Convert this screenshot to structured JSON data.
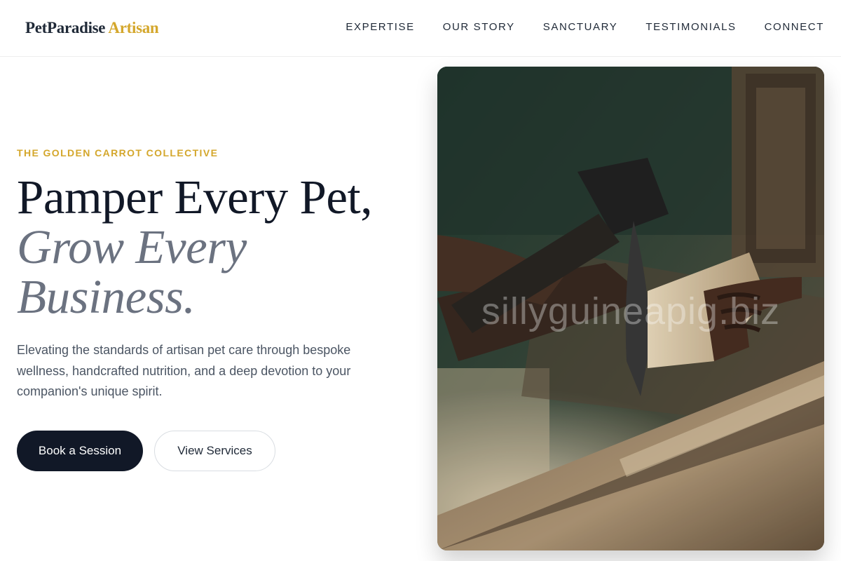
{
  "brand": {
    "name": "PetParadise",
    "accent": "Artisan",
    "accent_color": "#d4a72c"
  },
  "nav": {
    "items": [
      {
        "label": "EXPERTISE"
      },
      {
        "label": "OUR STORY"
      },
      {
        "label": "SANCTUARY"
      },
      {
        "label": "TESTIMONIALS"
      },
      {
        "label": "CONNECT"
      }
    ]
  },
  "hero": {
    "eyebrow": "THE GOLDEN CARROT COLLECTIVE",
    "headline_line1": "Pamper Every Pet,",
    "headline_line2": "Grow Every",
    "headline_line3": "Business.",
    "lead": "Elevating the standards of artisan pet care through bespoke wellness, handcrafted nutrition, and a deep devotion to your companion's unique spirit.",
    "primary_cta": "Book a Session",
    "secondary_cta": "View Services"
  },
  "image": {
    "subject": "hands-carving-wood-with-adze",
    "watermark": "sillyguineapig.biz"
  },
  "colors": {
    "dark": "#111827",
    "muted": "#6b7280",
    "gold": "#d4a72c"
  }
}
